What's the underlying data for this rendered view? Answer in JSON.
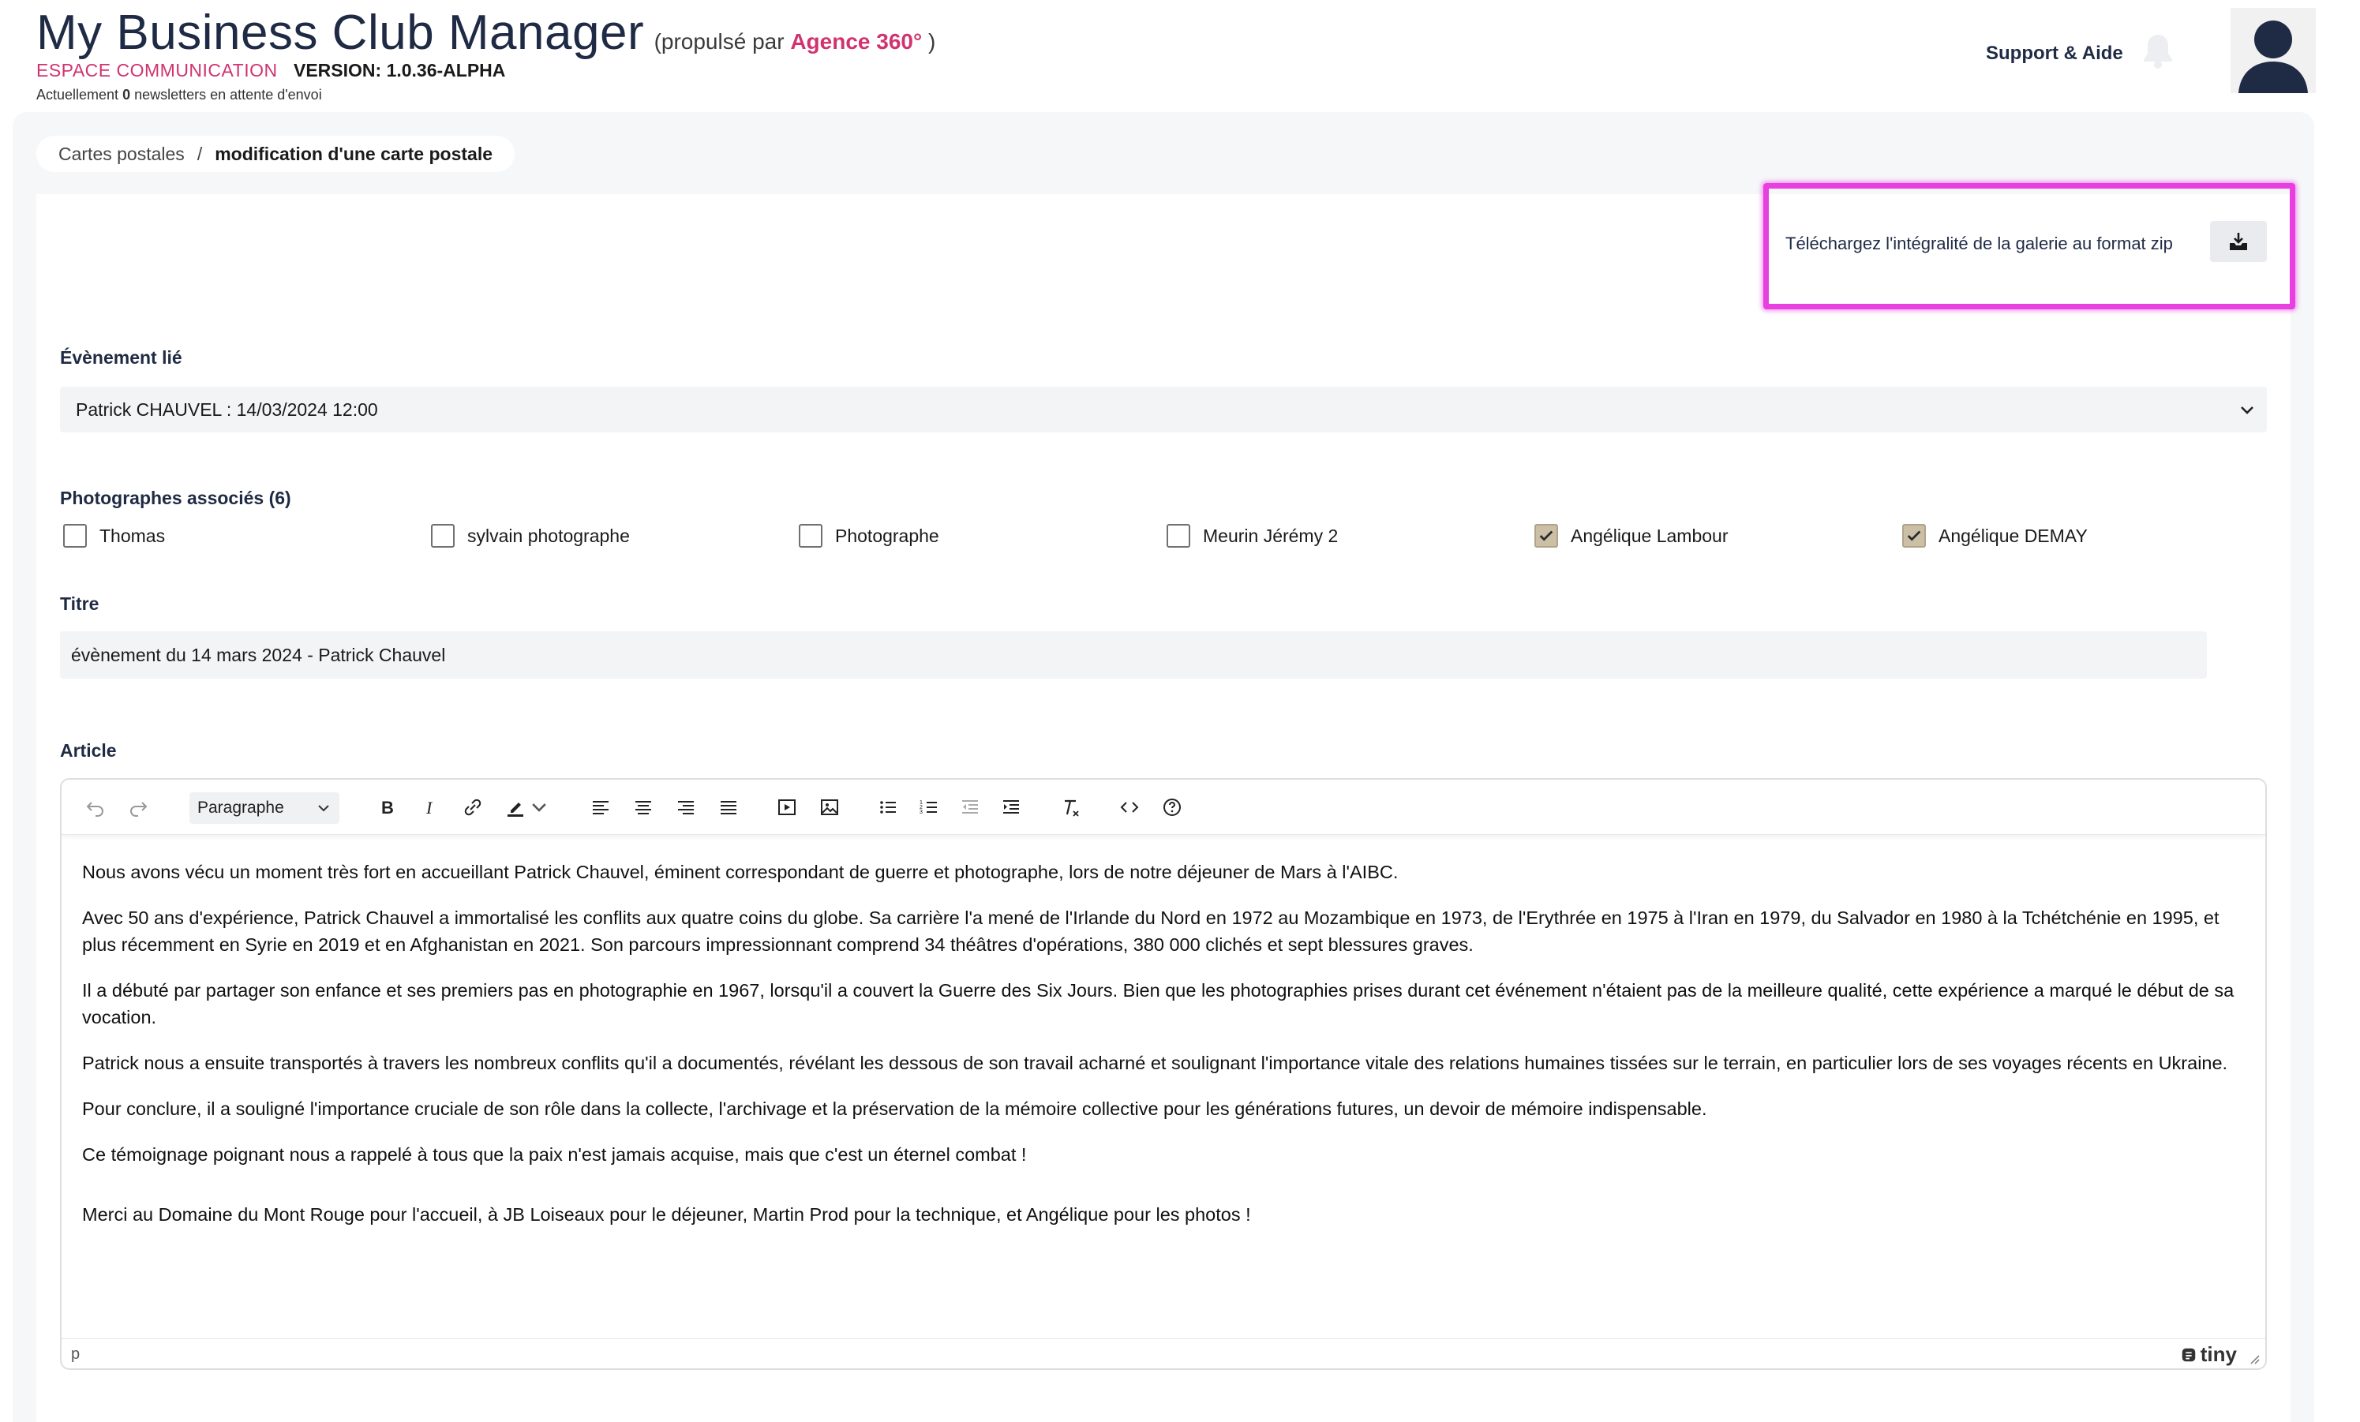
{
  "header": {
    "title": "My Business Club Manager",
    "powered_prefix": "(propulsé par",
    "powered_brand": "Agence 360°",
    "powered_suffix": ")",
    "space": "ESPACE COMMUNICATION",
    "version": "VERSION: 1.0.36-ALPHA",
    "pending_prefix": "Actuellement",
    "pending_count": "0",
    "pending_suffix": "newsletters en attente d'envoi",
    "support": "Support & Aide",
    "bell_icon": "bell-icon",
    "avatar_icon": "user-avatar-icon"
  },
  "breadcrumb": {
    "parent": "Cartes postales",
    "separator": "/",
    "current": "modification d'une carte postale"
  },
  "download": {
    "label": "Téléchargez l'intégralité de la galerie au format zip",
    "icon": "download-tray-icon",
    "highlight_color": "#e83fe0"
  },
  "event": {
    "label": "Évènement lié",
    "value": "Patrick CHAUVEL : 14/03/2024 12:00"
  },
  "photographers": {
    "label": "Photographes associés (6)",
    "items": [
      {
        "name": "Thomas",
        "checked": false
      },
      {
        "name": "sylvain photographe",
        "checked": false
      },
      {
        "name": "Photographe",
        "checked": false
      },
      {
        "name": "Meurin Jérémy 2",
        "checked": false
      },
      {
        "name": "Angélique Lambour",
        "checked": true
      },
      {
        "name": "Angélique DEMAY",
        "checked": true
      }
    ]
  },
  "title_field": {
    "label": "Titre",
    "value": "évènement du 14 mars 2024 - Patrick Chauvel"
  },
  "article": {
    "label": "Article",
    "format_select": "Paragraphe",
    "paragraphs": [
      "Nous avons vécu un moment très fort en accueillant Patrick Chauvel, éminent correspondant de guerre et photographe, lors de notre déjeuner de Mars à l'AIBC.",
      "Avec 50 ans d'expérience, Patrick Chauvel a immortalisé les conflits aux quatre coins du globe. Sa carrière l'a mené de l'Irlande du Nord en 1972 au Mozambique en 1973, de l'Erythrée en 1975 à l'Iran en 1979, du Salvador en 1980 à la Tchétchénie en 1995, et plus récemment en Syrie en 2019 et en Afghanistan en 2021. Son parcours impressionnant comprend 34 théâtres d'opérations, 380 000 clichés et sept blessures graves.",
      "Il a débuté par partager son enfance et ses premiers pas en photographie en 1967, lorsqu'il a couvert la Guerre des Six Jours. Bien que les photographies prises durant cet événement n'étaient pas de la meilleure qualité, cette expérience a marqué le début de sa vocation.",
      "Patrick nous a ensuite transportés à travers les nombreux conflits qu'il a documentés, révélant les dessous de son travail acharné et soulignant l'importance vitale des relations humaines tissées sur le terrain, en particulier lors de ses voyages récents en Ukraine.",
      "Pour conclure, il a souligné l'importance cruciale de son rôle dans la collecte, l'archivage et la préservation de la mémoire collective pour les générations futures, un devoir de mémoire indispensable.",
      "Ce témoignage poignant nous a rappelé à tous que la paix n'est jamais acquise, mais que c'est un éternel combat !",
      "Merci au Domaine du Mont Rouge pour l'accueil, à JB Loiseaux pour le déjeuner, Martin Prod pour la technique, et Angélique pour les photos !"
    ],
    "status_path": "p",
    "brand": "tiny"
  },
  "colors": {
    "accent": "#d1336f",
    "title": "#1f2a44",
    "check": "#cbbfa6"
  }
}
